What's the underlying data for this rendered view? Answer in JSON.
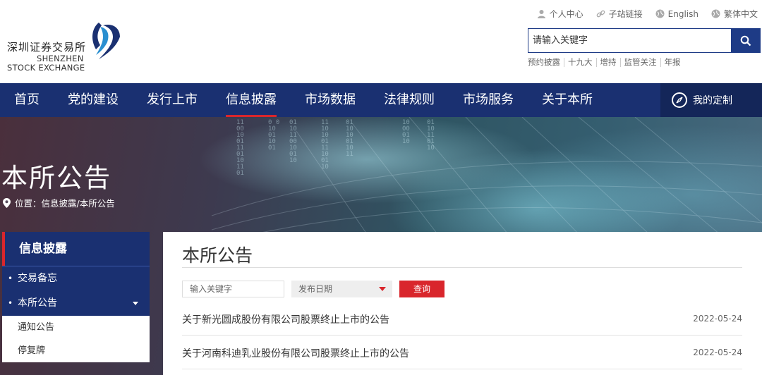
{
  "logo": {
    "name_cn": "深圳证券交易所",
    "name_en_line1": "SHENZHEN",
    "name_en_line2": "STOCK EXCHANGE"
  },
  "toplinks": [
    {
      "label": "个人中心",
      "icon": "person-icon"
    },
    {
      "label": "子站链接",
      "icon": "link-icon"
    },
    {
      "label": "English",
      "icon": "globe-icon"
    },
    {
      "label": "繁体中文",
      "icon": "globe-icon"
    }
  ],
  "search": {
    "placeholder": "请输入关键字",
    "button_icon": "search-icon"
  },
  "quick_links": [
    "预约披露",
    "十九大",
    "增持",
    "监管关注",
    "年报"
  ],
  "nav": {
    "items": [
      "首页",
      "党的建设",
      "发行上市",
      "信息披露",
      "市场数据",
      "法律规则",
      "市场服务",
      "关于本所"
    ],
    "active": "信息披露",
    "custom_label": "我的定制"
  },
  "banner": {
    "title": "本所公告",
    "breadcrumb": "位置：信息披露/本所公告"
  },
  "sidebar": {
    "heading": "信息披露",
    "items": [
      {
        "label": "交易备忘",
        "expanded": false
      },
      {
        "label": "本所公告",
        "expanded": true
      }
    ],
    "subitems": [
      "通知公告",
      "停复牌"
    ]
  },
  "content": {
    "title": "本所公告",
    "keyword_placeholder": "输入关键字",
    "date_placeholder": "发布日期",
    "query_label": "查询",
    "notices": [
      {
        "title": "关于新光圆成股份有限公司股票终止上市的公告",
        "date": "2022-05-24"
      },
      {
        "title": "关于河南科迪乳业股份有限公司股票终止上市的公告",
        "date": "2022-05-24"
      }
    ]
  },
  "colors": {
    "navy": "#1a3071",
    "accent_red": "#d9262c",
    "search_blue": "#1e3b86"
  }
}
